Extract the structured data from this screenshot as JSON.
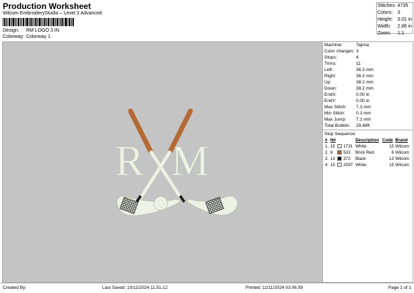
{
  "header": {
    "title": "Production Worksheet",
    "subtitle": "Wilcom EmbroideryStudio – Level 3 Advanced",
    "design_label": "Design:",
    "design_value": "RM LOGO 3 IN",
    "colorway_label": "Colorway:",
    "colorway_value": "Colorway 1"
  },
  "stats": [
    {
      "label": "Stitches:",
      "value": "4735"
    },
    {
      "label": "Colors:",
      "value": "3"
    },
    {
      "label": "Height:",
      "value": "3.01 in"
    },
    {
      "label": "Width:",
      "value": "2.86 in"
    },
    {
      "label": "Zoom:",
      "value": "1:1"
    }
  ],
  "design": {
    "letter_left": "R",
    "letter_right": "M",
    "colors": {
      "background": "#c4c4c4",
      "thread_white": "#f0f3e8",
      "thread_brown": "#b56a35",
      "thread_black": "#222222"
    }
  },
  "details": [
    {
      "label": "Machine:",
      "value": "Tajima"
    },
    {
      "label": "Color changes:",
      "value": "3"
    },
    {
      "label": "Stops:",
      "value": "4"
    },
    {
      "label": "Trims:",
      "value": "11"
    },
    {
      "label": "Left:",
      "value": "36.3 mm"
    },
    {
      "label": "Right:",
      "value": "36.3 mm"
    },
    {
      "label": "Up:",
      "value": "38.2 mm"
    },
    {
      "label": "Down:",
      "value": "38.2 mm"
    },
    {
      "label": "EndX:",
      "value": "0.00 in"
    },
    {
      "label": "EndY:",
      "value": "0.00 in"
    },
    {
      "label": "Max Stitch:",
      "value": "7.3 mm"
    },
    {
      "label": "Min Stitch:",
      "value": "0.3 mm"
    },
    {
      "label": "Max Jump:",
      "value": "7.1 mm"
    },
    {
      "label": "Total Bobbin:",
      "value": "29.48ft"
    }
  ],
  "sequence": {
    "title": "Stop Sequence:",
    "headers": [
      "#",
      "N#",
      "",
      "Description",
      "Code",
      "Brand"
    ],
    "rows": [
      {
        "idx": "1.",
        "n": "15",
        "swatch": "#ffffff",
        "code_num": "1731",
        "desc": "White",
        "code": "15",
        "brand": "Wilcom"
      },
      {
        "idx": "2.",
        "n": "6",
        "swatch": "#b56a35",
        "code_num": "533",
        "desc": "Brick Red",
        "code": "6",
        "brand": "Wilcom"
      },
      {
        "idx": "3.",
        "n": "13",
        "swatch": "#111111",
        "code_num": "372",
        "desc": "Black",
        "code": "13",
        "brand": "Wilcom"
      },
      {
        "idx": "4.",
        "n": "15",
        "swatch": "#ffffff",
        "code_num": "2097",
        "desc": "White",
        "code": "15",
        "brand": "Wilcom"
      }
    ]
  },
  "footer": {
    "created_by": "Created By:",
    "last_saved": "Last Saved: 10/11/2024 11.51.12",
    "printed": "Printed: 11/11/2024 03.06.59",
    "page": "Page 1 of 1"
  }
}
